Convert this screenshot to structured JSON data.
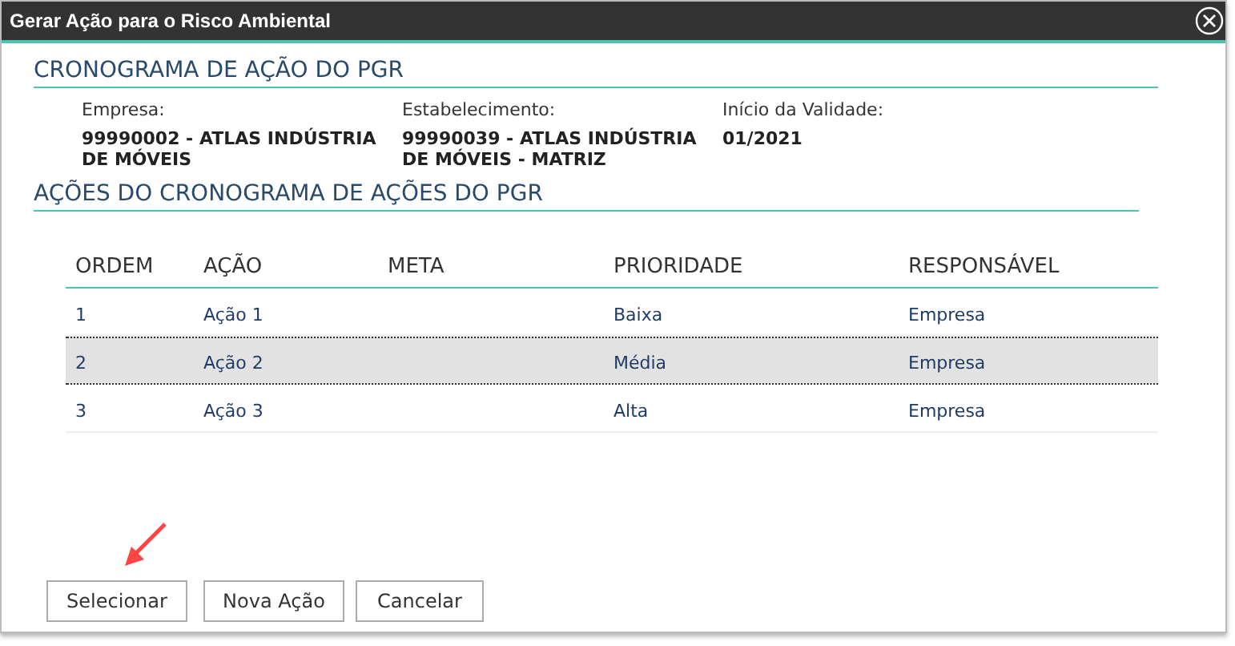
{
  "window": {
    "title": "Gerar Ação para o Risco Ambiental"
  },
  "section_1": {
    "title": "CRONOGRAMA DE AÇÃO DO PGR",
    "fields": [
      {
        "label": "Empresa:",
        "value": "99990002 - ATLAS INDÚSTRIA DE MÓVEIS"
      },
      {
        "label": "Estabelecimento:",
        "value": "99990039 - ATLAS INDÚSTRIA DE MÓVEIS - MATRIZ"
      },
      {
        "label": "Início da Validade:",
        "value": "01/2021"
      }
    ]
  },
  "section_2": {
    "title": "AÇÕES DO CRONOGRAMA DE AÇÕES DO PGR"
  },
  "table": {
    "columns": [
      "ORDEM",
      "AÇÃO",
      "META",
      "PRIORIDADE",
      "RESPONSÁVEL"
    ],
    "rows": [
      {
        "cells": [
          "1",
          "Ação 1",
          "",
          "Baixa",
          "Empresa"
        ],
        "selected": false
      },
      {
        "cells": [
          "2",
          "Ação 2",
          "",
          "Média",
          "Empresa"
        ],
        "selected": true
      },
      {
        "cells": [
          "3",
          "Ação 3",
          "",
          "Alta",
          "Empresa"
        ],
        "selected": false
      }
    ]
  },
  "buttons": [
    "Selecionar",
    "Nova Ação",
    "Cancelar"
  ]
}
